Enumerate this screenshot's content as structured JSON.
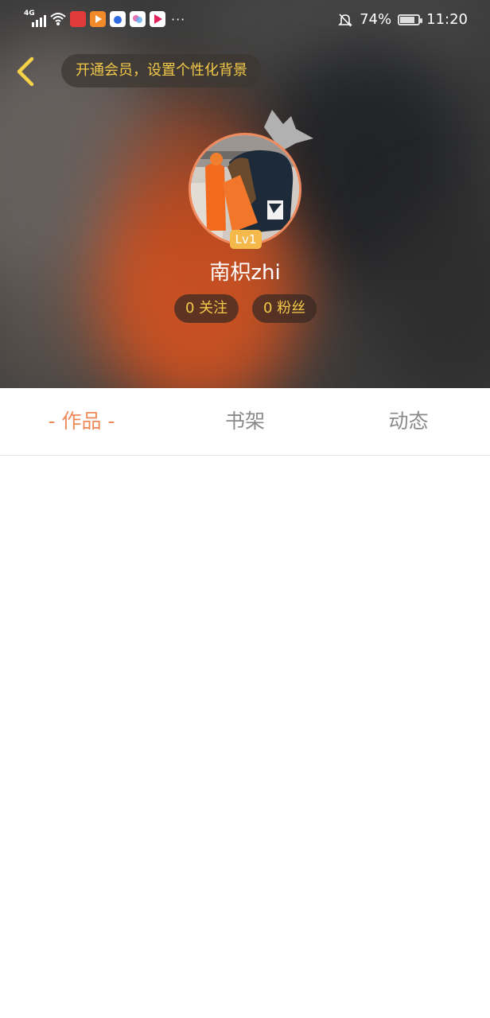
{
  "status_bar": {
    "network": "4G",
    "notifications_muted": true,
    "battery_percent": "74%",
    "time": "11:20",
    "more": "···"
  },
  "header": {
    "vip_prompt": "开通会员，设置个性化背景",
    "avatar_level": "Lv1",
    "username": "南枳zhi",
    "following": "0 关注",
    "followers": "0 粉丝"
  },
  "tabs": [
    {
      "label": "- 作品 -",
      "active": true
    },
    {
      "label": "书架",
      "active": false
    },
    {
      "label": "动态",
      "active": false
    }
  ],
  "colors": {
    "accent": "#ef8a5a",
    "gold": "#f3c94a",
    "badge": "#f5b84a",
    "tab_inactive": "#8a8a8a"
  }
}
